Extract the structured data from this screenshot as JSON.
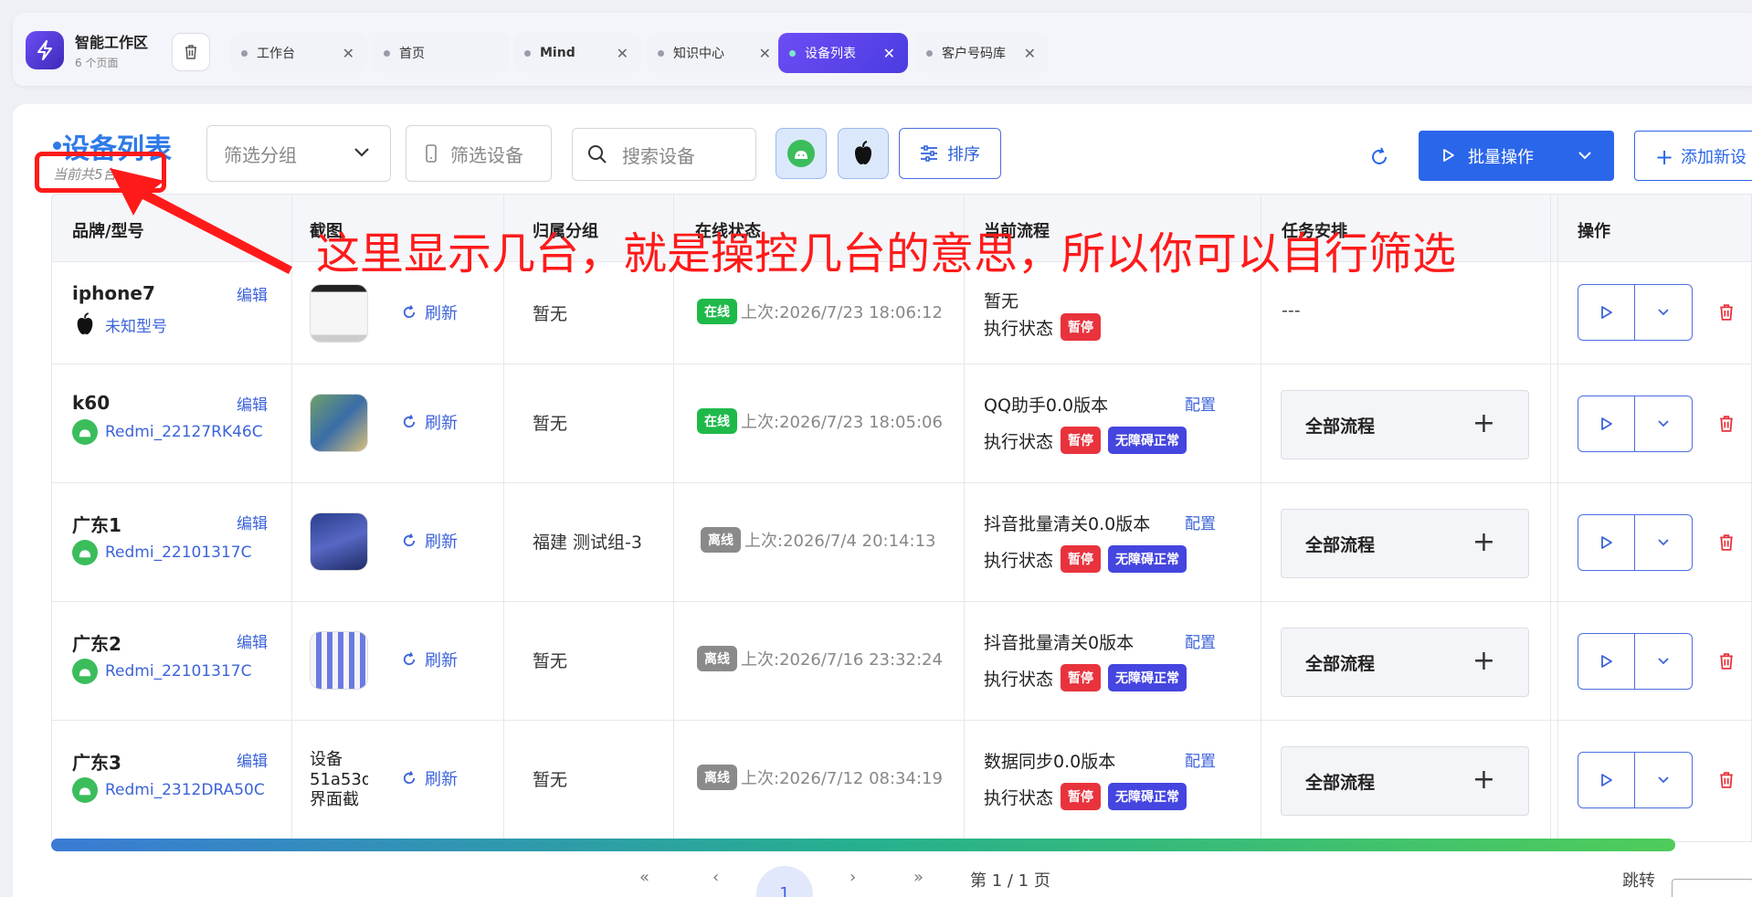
{
  "workspace": {
    "title": "智能工作区",
    "subtitle": "6 个页面"
  },
  "tabs": [
    {
      "label": "工作台",
      "closable": true
    },
    {
      "label": "首页",
      "closable": false
    },
    {
      "label": "Mind",
      "closable": true
    },
    {
      "label": "知识中心",
      "closable": true
    },
    {
      "label": "设备列表",
      "closable": true,
      "active": true
    },
    {
      "label": "客户号码库",
      "closable": true
    }
  ],
  "header": {
    "title": "设备列表",
    "count": "当前共5台",
    "group_filter_placeholder": "筛选分组",
    "device_filter_placeholder": "筛选设备",
    "search_placeholder": "搜索设备",
    "sort_label": "排序",
    "batch_label": "批量操作",
    "add_label": "添加新设"
  },
  "annotation": "这里显示几台，就是操控几台的意思，所以你可以自行筛选",
  "columns": [
    "品牌/型号",
    "截图",
    "归属分组",
    "在线状态",
    "当前流程",
    "任务安排",
    "操作"
  ],
  "row_labels": {
    "edit": "编辑",
    "refresh": "刷新",
    "config": "配置",
    "exec": "执行状态",
    "pause": "暂停",
    "a11y": "无障碍正常",
    "task": "全部流程"
  },
  "rows": [
    {
      "name": "iphone7",
      "os": "apple",
      "model": "未知型号",
      "group": "暂无",
      "online": "在线",
      "last": "上次:2026/7/23 18:06:12",
      "flow": "暂无",
      "has_config": false,
      "a11y": false,
      "task": "---"
    },
    {
      "name": "k60",
      "os": "android",
      "model": "Redmi_22127RK46C",
      "group": "暂无",
      "online": "在线",
      "last": "上次:2026/7/23 18:05:06",
      "flow": "QQ助手0.0版本",
      "has_config": true,
      "a11y": true,
      "task": "全部流程"
    },
    {
      "name": "广东1",
      "os": "android",
      "model": "Redmi_22101317C",
      "group": "福建 测试组-3",
      "online": "离线",
      "last": "上次:2026/7/4 20:14:13",
      "flow": "抖音批量清关0.0版本",
      "has_config": true,
      "a11y": true,
      "task": "全部流程"
    },
    {
      "name": "广东2",
      "os": "android",
      "model": "Redmi_22101317C",
      "group": "暂无",
      "online": "离线",
      "last": "上次:2026/7/16 23:32:24",
      "flow": "抖音批量清关0版本",
      "has_config": true,
      "a11y": true,
      "task": "全部流程"
    },
    {
      "name": "广东3",
      "os": "android",
      "model": "Redmi_2312DRA50C",
      "group": "暂无",
      "online": "离线",
      "last": "上次:2026/7/12 08:34:19",
      "flow": "数据同步0.0版本",
      "has_config": true,
      "a11y": true,
      "task": "全部流程",
      "thumb_alt": "设备51a53d界面截"
    }
  ],
  "pagination": {
    "first": "«",
    "prev": "‹",
    "current": "1",
    "next": "›",
    "last": "»",
    "summary": "第 1 / 1 页",
    "jump": "跳转"
  },
  "colors": {
    "accent": "#2a66ea",
    "online": "#1fb94a",
    "offline": "#8a8a8a",
    "pause": "#e8333d",
    "a11y": "#4545e0",
    "annotation": "#ff1a1a"
  }
}
